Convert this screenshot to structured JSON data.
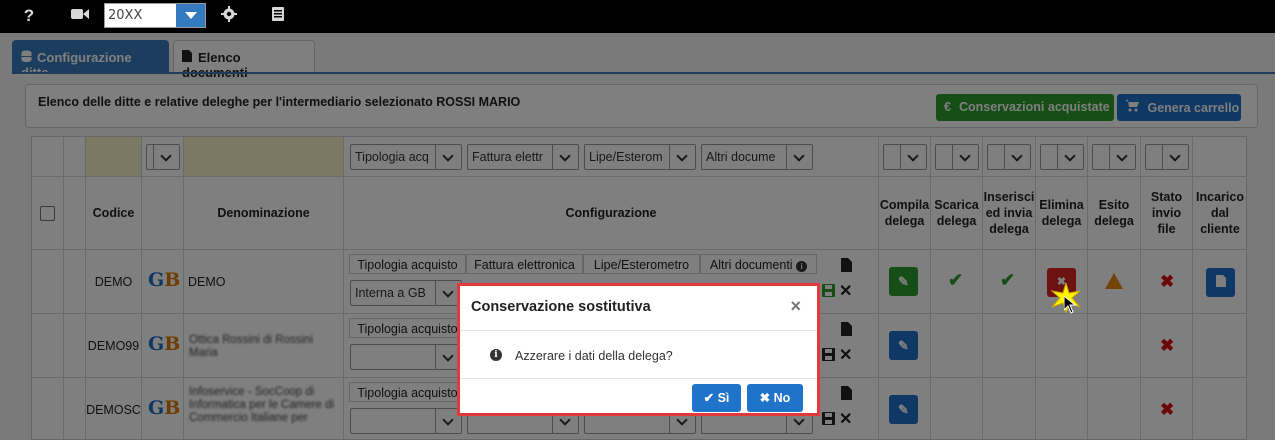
{
  "toolbar": {
    "help_icon": "?",
    "video_icon": "video-camera-icon",
    "year_value": "20XX",
    "settings_icon": "gear-icon",
    "book_icon": "book-icon"
  },
  "tabs": [
    {
      "label": "Configurazione ditte",
      "icon": "database-icon",
      "active": true
    },
    {
      "label": "Elenco documenti",
      "icon": "file-icon",
      "active": false
    }
  ],
  "info": {
    "text": "Elenco delle ditte e relative deleghe per l'intermediario selezionato ROSSI MARIO",
    "btn_conservazioni": "Conservazioni acquistate",
    "btn_conservazioni_icon": "€",
    "btn_carrello": "Genera carrello"
  },
  "filters": {
    "tipologia": "Tipologia acq",
    "fattura": "Fattura elettr",
    "lipe": "Lipe/Esterom",
    "altri": "Altri docume"
  },
  "headers": {
    "codice": "Codice",
    "denominazione": "Denominazione",
    "configurazione": "Configurazione",
    "compila": "Compila delega",
    "scarica": "Scarica delega",
    "inserisci": "Inserisci ed invia delega",
    "elimina": "Elimina delega",
    "esito": "Esito delega",
    "stato": "Stato invio file",
    "incarico": "Incarico dal cliente"
  },
  "subheaders": {
    "tipologia": "Tipologia acquisto",
    "fattura": "Fattura elettronica",
    "lipe": "Lipe/Esterometro",
    "altri": "Altri documenti"
  },
  "rows": [
    {
      "codice": "DEMO",
      "denominazione": "DEMO",
      "tipologia": "Interna a GB"
    },
    {
      "codice": "DEMO99",
      "denominazione": "Ottica Rossini di Rossini Maria",
      "tipologia": ""
    },
    {
      "codice": "DEMOSC",
      "denominazione": "Infoservice - SocCoop di Informatica per le Camere di Commercio Italiane per",
      "tipologia": ""
    }
  ],
  "row_subheader_tipologia": "Tipologia acquisto",
  "logo_text": "GB",
  "modal": {
    "title": "Conservazione sostitutiva",
    "close": "×",
    "message": "Azzerare i dati della delega?",
    "yes": "Sì",
    "no": "No"
  }
}
